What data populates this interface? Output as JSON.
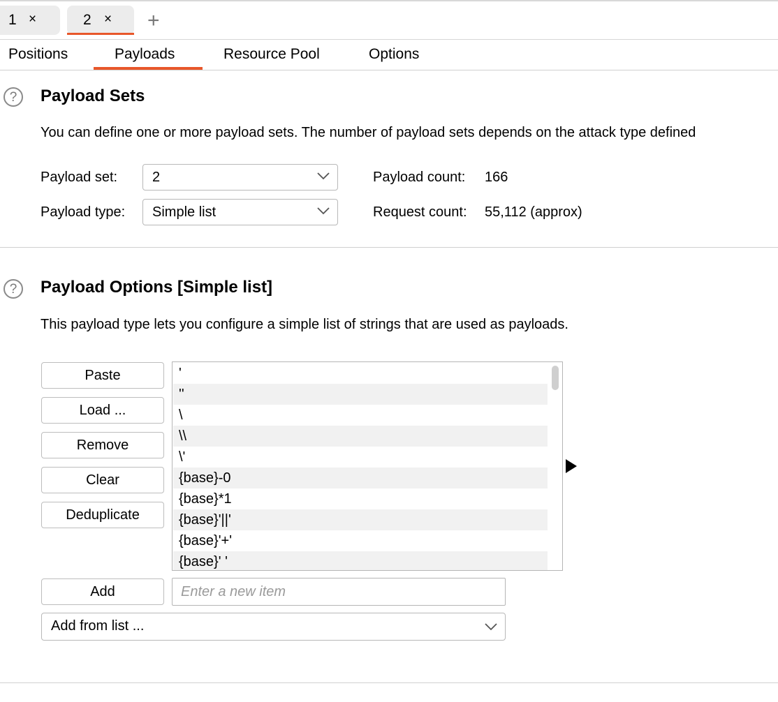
{
  "instance_tabs": [
    {
      "label": "1",
      "close": "×"
    },
    {
      "label": "2",
      "close": "×"
    }
  ],
  "add_tab_label": "+",
  "sub_tabs": [
    "Positions",
    "Payloads",
    "Resource Pool",
    "Options"
  ],
  "active_sub_tab": "Payloads",
  "accent_color": "#e8572a",
  "help_glyph": "?",
  "payload_sets": {
    "title": "Payload Sets",
    "description": "You can define one or more payload sets. The number of payload sets depends on the attack type defined",
    "set_label": "Payload set:",
    "set_value": "2",
    "type_label": "Payload type:",
    "type_value": "Simple list",
    "payload_count_label": "Payload count:",
    "payload_count_value": "166",
    "request_count_label": "Request count:",
    "request_count_value": "55,112 (approx)"
  },
  "payload_options": {
    "title": "Payload Options [Simple list]",
    "description": "This payload type lets you configure a simple list of strings that are used as payloads.",
    "buttons": {
      "paste": "Paste",
      "load": "Load ...",
      "remove": "Remove",
      "clear": "Clear",
      "deduplicate": "Deduplicate",
      "add": "Add"
    },
    "items": [
      "'",
      "''",
      "\\",
      "\\\\",
      "\\'",
      "{base}-0",
      "{base}*1",
      "{base}'||'",
      "{base}'+'",
      "{base}' '"
    ],
    "new_item_placeholder": "Enter a new item",
    "add_from_list": "Add from list ..."
  }
}
